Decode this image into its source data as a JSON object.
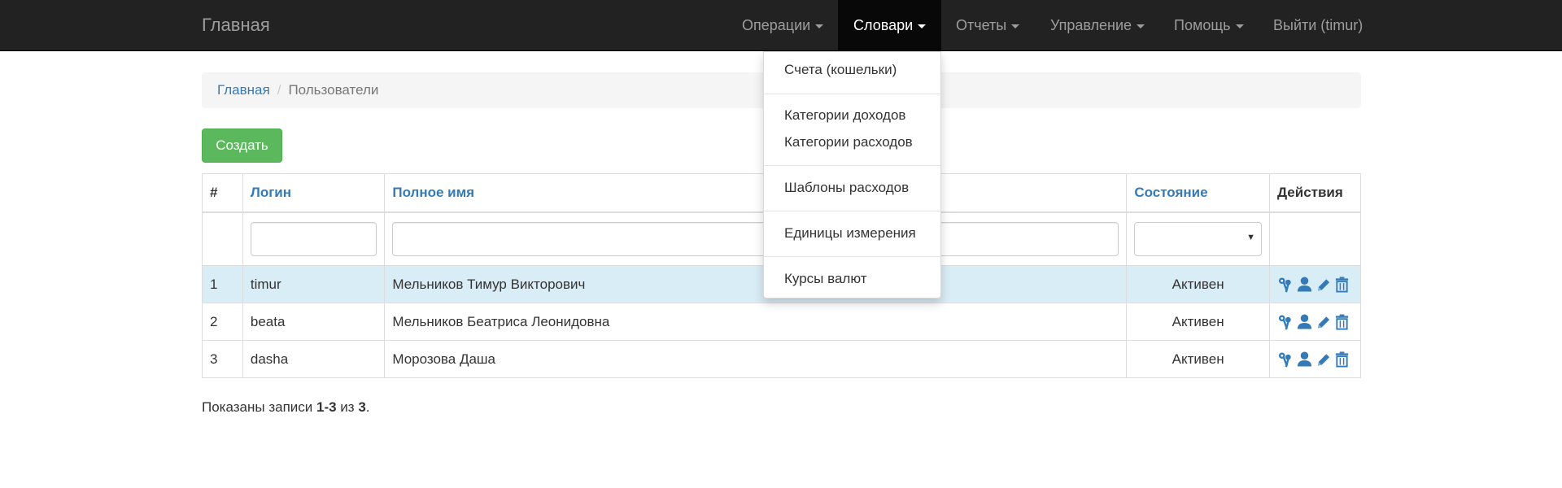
{
  "navbar": {
    "brand": "Главная",
    "items": [
      {
        "label": "Операции",
        "dropdown": true
      },
      {
        "label": "Словари",
        "dropdown": true,
        "active": true
      },
      {
        "label": "Отчеты",
        "dropdown": true
      },
      {
        "label": "Управление",
        "dropdown": true
      },
      {
        "label": "Помощь",
        "dropdown": true
      },
      {
        "label": "Выйти (timur)",
        "dropdown": false
      }
    ]
  },
  "dropdown_menu": {
    "items": [
      "Счета (кошельки)",
      "Категории доходов",
      "Категории расходов",
      "Шаблоны расходов",
      "Единицы измерения",
      "Курсы валют"
    ]
  },
  "breadcrumb": {
    "home": "Главная",
    "separator": "/",
    "current": "Пользователи"
  },
  "create_button": "Создать",
  "table": {
    "headers": {
      "num": "#",
      "login": "Логин",
      "fullname": "Полное имя",
      "status": "Состояние",
      "actions": "Действия"
    },
    "filters": {
      "login": "",
      "fullname": "",
      "status": ""
    },
    "rows": [
      {
        "num": "1",
        "login": "timur",
        "fullname": "Мельников Тимур Викторович",
        "status": "Активен"
      },
      {
        "num": "2",
        "login": "beata",
        "fullname": "Мельников Беатриса Леонидовна",
        "status": "Активен"
      },
      {
        "num": "3",
        "login": "dasha",
        "fullname": "Морозова Даша",
        "status": "Активен"
      }
    ],
    "row_actions": [
      "keys-icon",
      "user-icon",
      "pencil-icon",
      "trash-icon"
    ]
  },
  "summary": {
    "prefix": "Показаны записи ",
    "range": "1-3",
    "middle": " из ",
    "total": "3",
    "suffix": "."
  },
  "colors": {
    "navbar_bg": "#222222",
    "link": "#337ab7",
    "success": "#5cb85c",
    "row_highlight": "#d9edf7"
  }
}
